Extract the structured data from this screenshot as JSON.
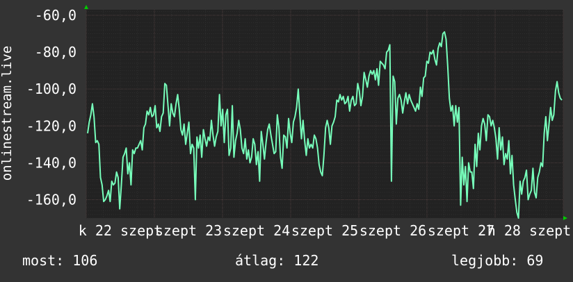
{
  "chart_data": {
    "type": "line",
    "ylabel": "onlinestream.live",
    "ylim": [
      -170,
      -57
    ],
    "yticks": [
      -60,
      -80,
      -100,
      -120,
      -140,
      -160
    ],
    "ytick_labels": [
      "-60,0",
      "-80,0",
      "-100,0",
      "-120,0",
      "-140,0",
      "-160,0"
    ],
    "xticks": [
      {
        "label": "k 22 szept",
        "at": 0.5
      },
      {
        "label": "szept 23",
        "at": 1.5
      },
      {
        "label": "szept 24",
        "at": 2.5
      },
      {
        "label": "szept 25",
        "at": 3.5
      },
      {
        "label": "szept 26",
        "at": 4.5
      },
      {
        "label": "szept 27",
        "at": 5.5
      },
      {
        "label": "h 28 szept",
        "at": 6.5
      }
    ],
    "xrange": [
      0,
      7
    ],
    "grid": true,
    "colors": {
      "background": "#333333",
      "plot": "#222222",
      "line": "#77ffbb",
      "grid_major": "#4a3a3a",
      "grid_minor": "#2e2e2e",
      "axis_arrow": "#00cc00"
    },
    "series": [
      {
        "values": [
          -124,
          -118,
          -114,
          -108,
          -115,
          -129,
          -128,
          -130,
          -148,
          -152,
          -161,
          -160,
          -158,
          -155,
          -161,
          -150,
          -152,
          -151,
          -145,
          -148,
          -165,
          -152,
          -137,
          -135,
          -132,
          -146,
          -140,
          -152,
          -133,
          -135,
          -132,
          -132,
          -130,
          -128,
          -133,
          -121,
          -119,
          -112,
          -114,
          -110,
          -115,
          -114,
          -109,
          -121,
          -119,
          -123,
          -115,
          -113,
          -97,
          -98,
          -109,
          -120,
          -108,
          -113,
          -115,
          -108,
          -103,
          -111,
          -122,
          -125,
          -119,
          -130,
          -124,
          -118,
          -135,
          -130,
          -132,
          -160,
          -126,
          -132,
          -125,
          -137,
          -122,
          -127,
          -131,
          -126,
          -128,
          -117,
          -125,
          -131,
          -126,
          -123,
          -103,
          -120,
          -111,
          -129,
          -114,
          -111,
          -136,
          -132,
          -109,
          -137,
          -128,
          -124,
          -117,
          -122,
          -132,
          -135,
          -127,
          -138,
          -133,
          -140,
          -137,
          -127,
          -130,
          -141,
          -134,
          -150,
          -123,
          -130,
          -138,
          -129,
          -122,
          -119,
          -125,
          -130,
          -135,
          -134,
          -114,
          -121,
          -137,
          -143,
          -125,
          -126,
          -132,
          -116,
          -124,
          -129,
          -118,
          -115,
          -110,
          -100,
          -114,
          -127,
          -117,
          -128,
          -136,
          -127,
          -132,
          -130,
          -132,
          -125,
          -127,
          -132,
          -141,
          -145,
          -147,
          -136,
          -121,
          -117,
          -121,
          -130,
          -120,
          -118,
          -115,
          -106,
          -107,
          -103,
          -106,
          -104,
          -108,
          -107,
          -104,
          -112,
          -106,
          -104,
          -109,
          -108,
          -97,
          -101,
          -109,
          -104,
          -91,
          -95,
          -99,
          -93,
          -90,
          -92,
          -90,
          -95,
          -89,
          -98,
          -85,
          -86,
          -87,
          -89,
          -80,
          -79,
          -76,
          -150,
          -93,
          -96,
          -119,
          -105,
          -103,
          -106,
          -113,
          -107,
          -102,
          -108,
          -103,
          -106,
          -108,
          -110,
          -112,
          -108,
          -111,
          -99,
          -104,
          -94,
          -93,
          -85,
          -86,
          -80,
          -81,
          -79,
          -84,
          -87,
          -78,
          -75,
          -77,
          -70,
          -69,
          -73,
          -88,
          -105,
          -112,
          -109,
          -120,
          -109,
          -118,
          -110,
          -163,
          -137,
          -152,
          -142,
          -161,
          -140,
          -145,
          -145,
          -154,
          -130,
          -142,
          -124,
          -133,
          -120,
          -116,
          -119,
          -128,
          -114,
          -115,
          -120,
          -117,
          -121,
          -127,
          -138,
          -121,
          -133,
          -126,
          -141,
          -135,
          -138,
          -128,
          -146,
          -136,
          -152,
          -160,
          -167,
          -170,
          -150,
          -157,
          -150,
          -148,
          -144,
          -160,
          -157,
          -155,
          -143,
          -156,
          -159,
          -148,
          -145,
          -140,
          -142,
          -124,
          -115,
          -128,
          -119,
          -110,
          -117,
          -114,
          -101,
          -96,
          -102,
          -105,
          -106
        ]
      }
    ]
  },
  "stats": {
    "now": "most: 106",
    "avg": "átlag: 122",
    "best": "legjobb: 69"
  }
}
